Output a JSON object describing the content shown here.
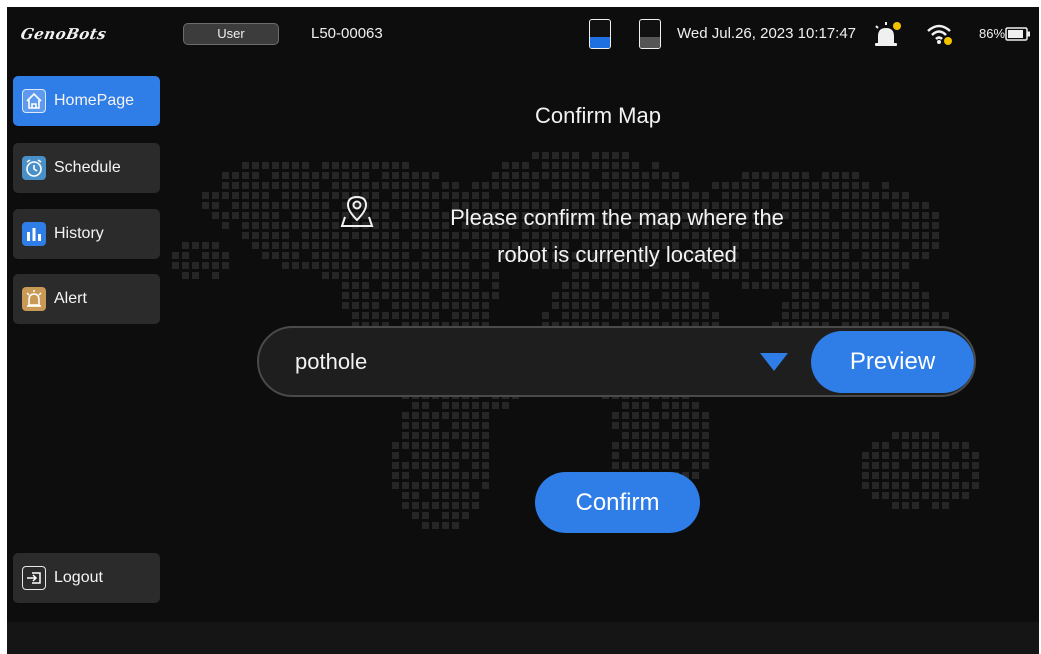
{
  "header": {
    "logo_text": "GenoBots",
    "user_label": "User",
    "device_id": "L50-00063",
    "datetime": "Wed Jul.26, 2023 10:17:47",
    "battery_percent": "86%",
    "tank_levels": {
      "clean": 0.4,
      "dirty": 0.38
    },
    "colors": {
      "clean_tank": "#1e6fe0",
      "dirty_tank": "#555555",
      "alarm_dot": "#f2c200",
      "wifi_dot": "#f2c200"
    }
  },
  "sidebar": {
    "items": [
      {
        "label": "HomePage",
        "icon": "home-icon",
        "active": true
      },
      {
        "label": "Schedule",
        "icon": "clock-icon",
        "active": false
      },
      {
        "label": "History",
        "icon": "bar-chart-icon",
        "active": false
      },
      {
        "label": "Alert",
        "icon": "alarm-bell-icon",
        "active": false
      }
    ],
    "logout": {
      "label": "Logout",
      "icon": "logout-icon"
    }
  },
  "main": {
    "title": "Confirm Map",
    "prompt_line1": "Please confirm the map where the",
    "prompt_line2": "robot is currently located",
    "selected_map": "pothole",
    "preview_label": "Preview",
    "confirm_label": "Confirm"
  },
  "colors": {
    "accent": "#2f7de6",
    "background": "#0d0d0d",
    "nav_bg": "#2b2b2b"
  }
}
